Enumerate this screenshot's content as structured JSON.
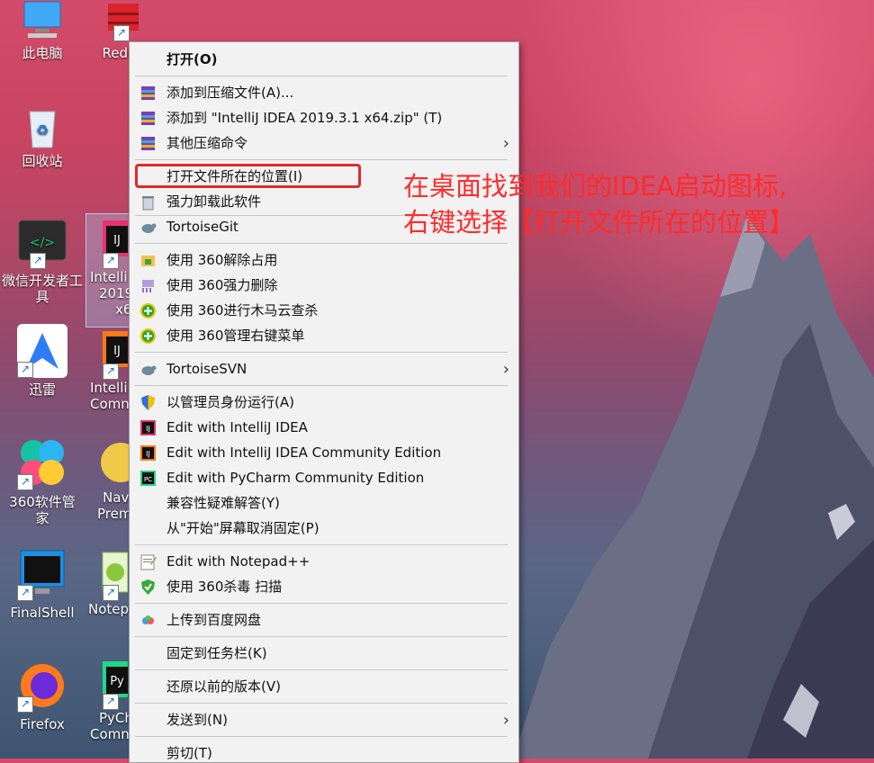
{
  "desktop": {
    "icons": [
      {
        "label": "此电脑"
      },
      {
        "label": "RedisI"
      },
      {
        "label": "回收站"
      },
      {
        "label": "微信开发者工"
      },
      {
        "label": "具"
      },
      {
        "label": "Intelli"
      },
      {
        "label": "2019"
      },
      {
        "label": "x6"
      },
      {
        "label": "迅雷"
      },
      {
        "label": "Intelli"
      },
      {
        "label": "Comn"
      },
      {
        "label": "360软件管家"
      },
      {
        "label": "Nav"
      },
      {
        "label": "Prem"
      },
      {
        "label": "FinalShell"
      },
      {
        "label": "Notep"
      },
      {
        "label": "Firefox"
      },
      {
        "label": "PyCh"
      },
      {
        "label": "Comn"
      }
    ]
  },
  "menu": {
    "items": [
      {
        "label": "打开(O)",
        "icon": "none"
      },
      {
        "label": "添加到压缩文件(A)...",
        "icon": "winrar-icon"
      },
      {
        "label": "添加到 \"IntelliJ IDEA 2019.3.1 x64.zip\" (T)",
        "icon": "winrar-icon"
      },
      {
        "label": "其他压缩命令",
        "icon": "winrar-icon",
        "arrow": "›"
      },
      {
        "label": "打开文件所在的位置(I)",
        "icon": "none"
      },
      {
        "label": "强力卸载此软件",
        "icon": "trash-icon"
      },
      {
        "label": "TortoiseGit",
        "icon": "tortoise-icon"
      },
      {
        "label": "使用 360解除占用",
        "icon": "folder-unlock-icon"
      },
      {
        "label": "使用 360强力删除",
        "icon": "shred-icon"
      },
      {
        "label": "使用 360进行木马云查杀",
        "icon": "plus-green-icon"
      },
      {
        "label": "使用 360管理右键菜单",
        "icon": "plus-green-icon"
      },
      {
        "label": "TortoiseSVN",
        "icon": "tortoise-icon",
        "arrow": "›"
      },
      {
        "label": "以管理员身份运行(A)",
        "icon": "shield-icon"
      },
      {
        "label": "Edit with IntelliJ IDEA",
        "icon": "intellij-icon"
      },
      {
        "label": "Edit with IntelliJ IDEA Community Edition",
        "icon": "intellij-icon"
      },
      {
        "label": "Edit with PyCharm Community Edition",
        "icon": "pycharm-icon"
      },
      {
        "label": "兼容性疑难解答(Y)",
        "icon": "none"
      },
      {
        "label": "从\"开始\"屏幕取消固定(P)",
        "icon": "none"
      },
      {
        "label": "Edit with Notepad++",
        "icon": "notepad-icon"
      },
      {
        "label": "使用 360杀毒 扫描",
        "icon": "shield-green-icon"
      },
      {
        "label": "上传到百度网盘",
        "icon": "baidu-cloud-icon"
      },
      {
        "label": "固定到任务栏(K)",
        "icon": "none"
      },
      {
        "label": "还原以前的版本(V)",
        "icon": "none"
      },
      {
        "label": "发送到(N)",
        "icon": "none",
        "arrow": "›"
      },
      {
        "label": "剪切(T)",
        "icon": "none"
      }
    ]
  },
  "annotation": {
    "line1": "在桌面找到我们的IDEA启动图标,",
    "line2": "右键选择【打开文件所在的位置】",
    "color": "#ff2b2b"
  }
}
